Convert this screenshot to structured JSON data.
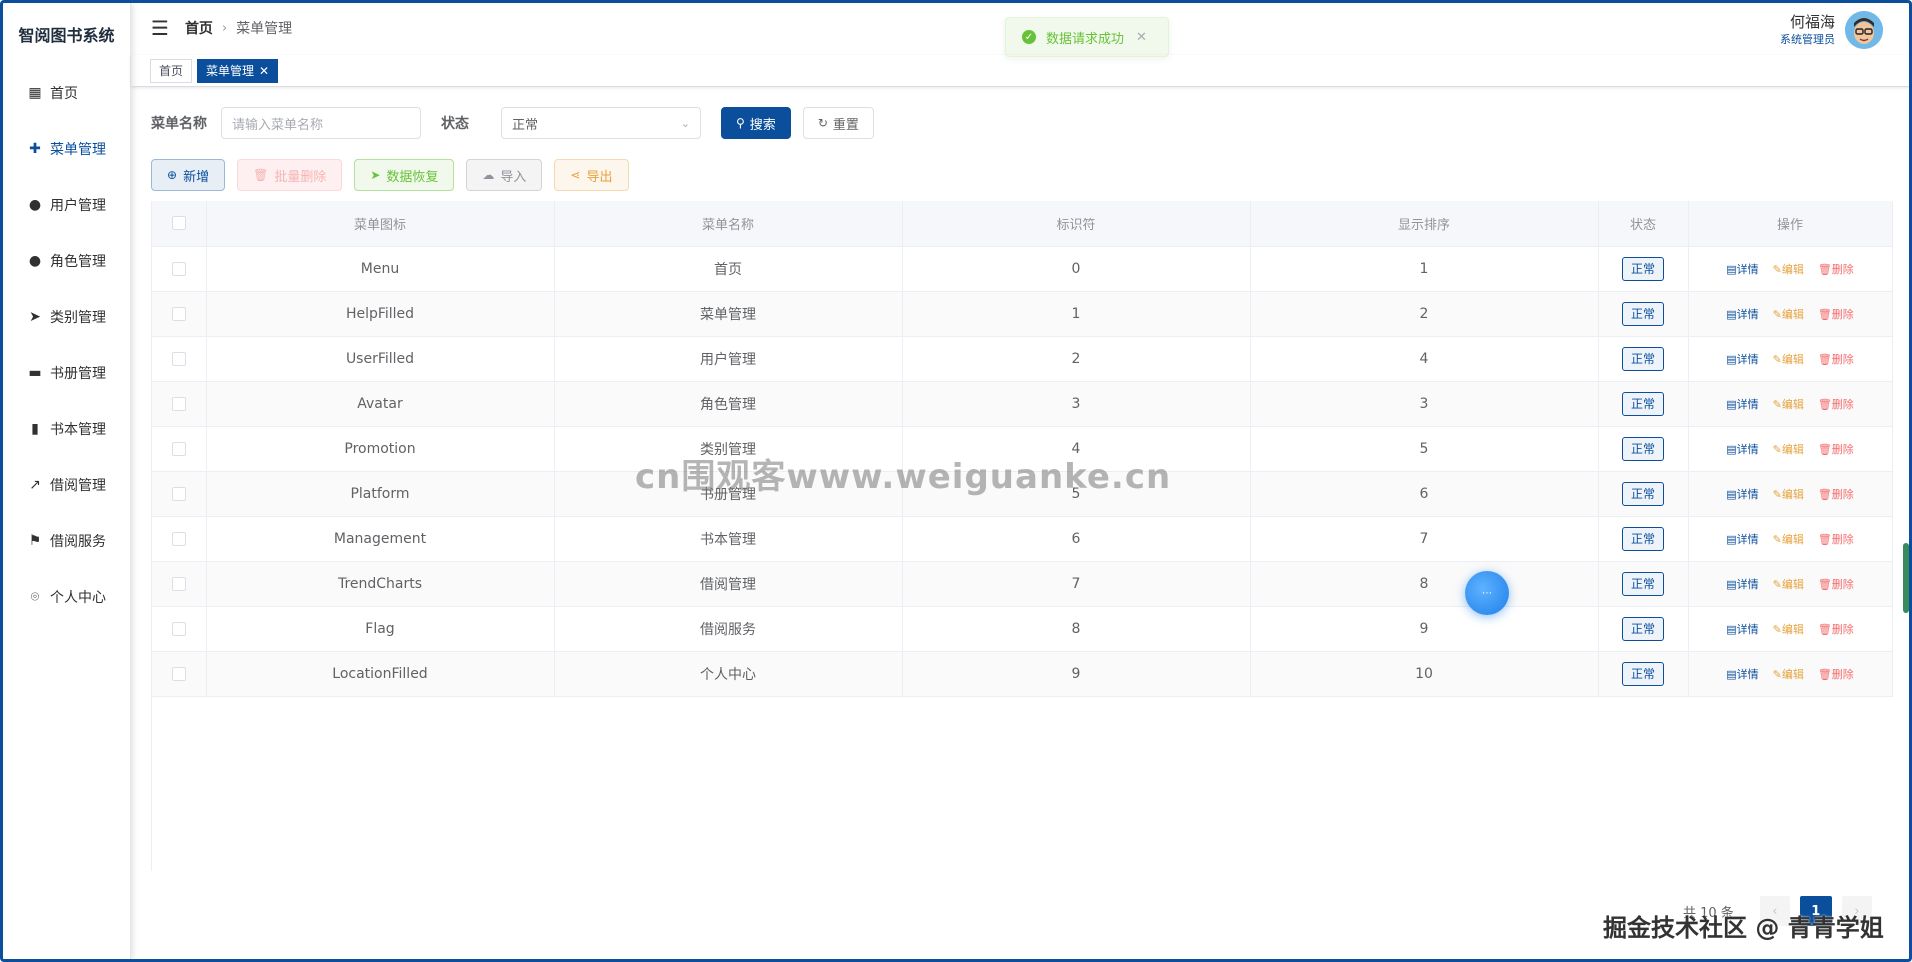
{
  "app": {
    "title": "智阅图书系统"
  },
  "sidebar": {
    "items": [
      {
        "label": "首页",
        "icon": "grid-icon",
        "glyph": "▦"
      },
      {
        "label": "菜单管理",
        "icon": "help-filled-icon",
        "glyph": "✚"
      },
      {
        "label": "用户管理",
        "icon": "user-icon",
        "glyph": "●"
      },
      {
        "label": "角色管理",
        "icon": "avatar-icon",
        "glyph": "●"
      },
      {
        "label": "类别管理",
        "icon": "promotion-icon",
        "glyph": "➤"
      },
      {
        "label": "书册管理",
        "icon": "platform-icon",
        "glyph": "▬"
      },
      {
        "label": "书本管理",
        "icon": "management-icon",
        "glyph": "▮"
      },
      {
        "label": "借阅管理",
        "icon": "trend-charts-icon",
        "glyph": "↗"
      },
      {
        "label": "借阅服务",
        "icon": "flag-icon",
        "glyph": "⚑"
      },
      {
        "label": "个人中心",
        "icon": "location-icon",
        "glyph": "⌾"
      }
    ]
  },
  "header": {
    "breadcrumb_home": "首页",
    "breadcrumb_current": "菜单管理",
    "user_name": "何福海",
    "user_role": "系统管理员"
  },
  "toast": {
    "message": "数据请求成功"
  },
  "tags": [
    {
      "label": "首页"
    },
    {
      "label": "菜单管理"
    }
  ],
  "search": {
    "name_label": "菜单名称",
    "name_placeholder": "请输入菜单名称",
    "status_label": "状态",
    "status_value": "正常",
    "search_button": "搜索",
    "reset_button": "重置"
  },
  "toolbar": {
    "add": "新增",
    "batch_delete": "批量删除",
    "restore": "数据恢复",
    "import": "导入",
    "export": "导出"
  },
  "table": {
    "headers": [
      "菜单图标",
      "菜单名称",
      "标识符",
      "显示排序",
      "状态",
      "操作"
    ],
    "rows": [
      {
        "icon": "Menu",
        "name": "首页",
        "id": "0",
        "order": "1",
        "status": "正常"
      },
      {
        "icon": "HelpFilled",
        "name": "菜单管理",
        "id": "1",
        "order": "2",
        "status": "正常"
      },
      {
        "icon": "UserFilled",
        "name": "用户管理",
        "id": "2",
        "order": "4",
        "status": "正常"
      },
      {
        "icon": "Avatar",
        "name": "角色管理",
        "id": "3",
        "order": "3",
        "status": "正常"
      },
      {
        "icon": "Promotion",
        "name": "类别管理",
        "id": "4",
        "order": "5",
        "status": "正常"
      },
      {
        "icon": "Platform",
        "name": "书册管理",
        "id": "5",
        "order": "6",
        "status": "正常"
      },
      {
        "icon": "Management",
        "name": "书本管理",
        "id": "6",
        "order": "7",
        "status": "正常"
      },
      {
        "icon": "TrendCharts",
        "name": "借阅管理",
        "id": "7",
        "order": "8",
        "status": "正常"
      },
      {
        "icon": "Flag",
        "name": "借阅服务",
        "id": "8",
        "order": "9",
        "status": "正常"
      },
      {
        "icon": "LocationFilled",
        "name": "个人中心",
        "id": "9",
        "order": "10",
        "status": "正常"
      }
    ],
    "actions": {
      "detail": "详情",
      "edit": "编辑",
      "remove": "删除"
    }
  },
  "pagination": {
    "total_text": "共 10 条",
    "current_page": "1"
  },
  "watermarks": {
    "center": "cn围观客www.weiguanke.cn",
    "corner": "掘金技术社区 @ 青青学姐"
  },
  "colors": {
    "primary": "#0b4f9c",
    "success": "#67c23a",
    "warning": "#e6a23c",
    "danger": "#f56c6c"
  }
}
